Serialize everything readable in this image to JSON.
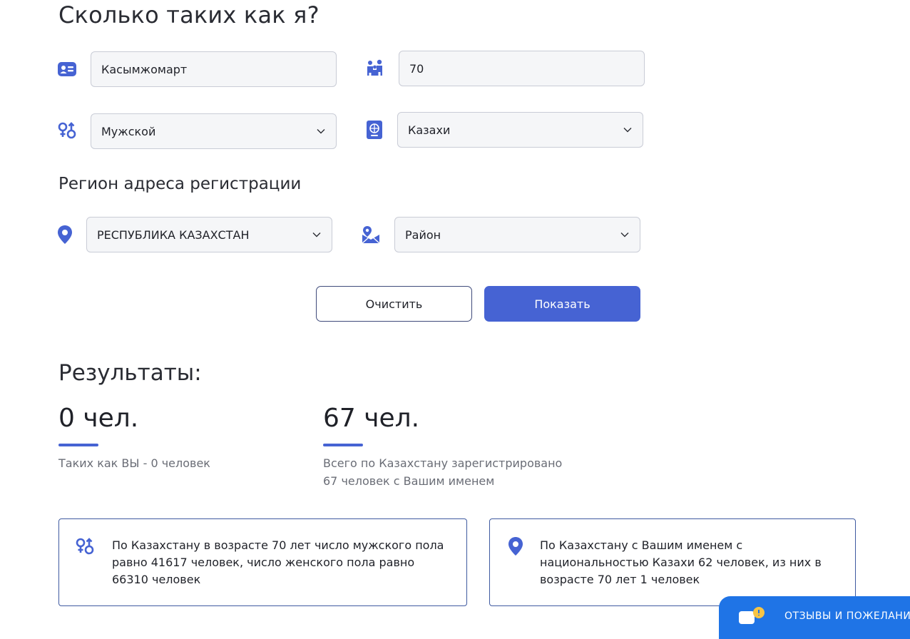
{
  "page": {
    "title": "Сколько таких как я?",
    "region_section_title": "Регион адреса регистрации",
    "results_title": "Результаты:"
  },
  "form": {
    "name": {
      "value": "Касымжомарт",
      "icon": "id-card-icon"
    },
    "age": {
      "value": "70",
      "icon": "family-icon"
    },
    "gender": {
      "value": "Мужской",
      "icon": "gender-icon"
    },
    "nationality": {
      "value": "Казахи",
      "icon": "passport-icon"
    },
    "region": {
      "value": "РЕСПУБЛИКА КАЗАХСТАН",
      "icon": "location-pin-icon"
    },
    "district": {
      "value": "Район",
      "icon": "map-location-icon"
    }
  },
  "buttons": {
    "clear": "Очистить",
    "show": "Показать"
  },
  "results": {
    "like_you": {
      "count": "0 чел.",
      "desc": "Таких как ВЫ - 0 человек"
    },
    "total": {
      "count": "67 чел.",
      "desc_line1": "Всего по Казахстану зарегистрировано",
      "desc_line2": "67 человек с Вашим именем"
    }
  },
  "cards": {
    "gender_stats": {
      "line1": "По Казахстану в возрасте 70 лет число мужского пола",
      "line2": "равно 41617 человек, число женского пола равно",
      "line3": "66310 человек"
    },
    "nationality_stats": {
      "line1": "По Казахстану с Вашим именем с",
      "line2": "национальностью Казахи 62 человек, из них в",
      "line3": "возрасте 70 лет 1 человек"
    }
  },
  "feedback": {
    "label": "ОТЗЫВЫ И ПОЖЕЛАНИЯ"
  },
  "colors": {
    "accent": "#4663d3",
    "field_bg": "#f5f6f8",
    "field_border": "#c9ccd6",
    "feedback": "#1f74e6"
  }
}
